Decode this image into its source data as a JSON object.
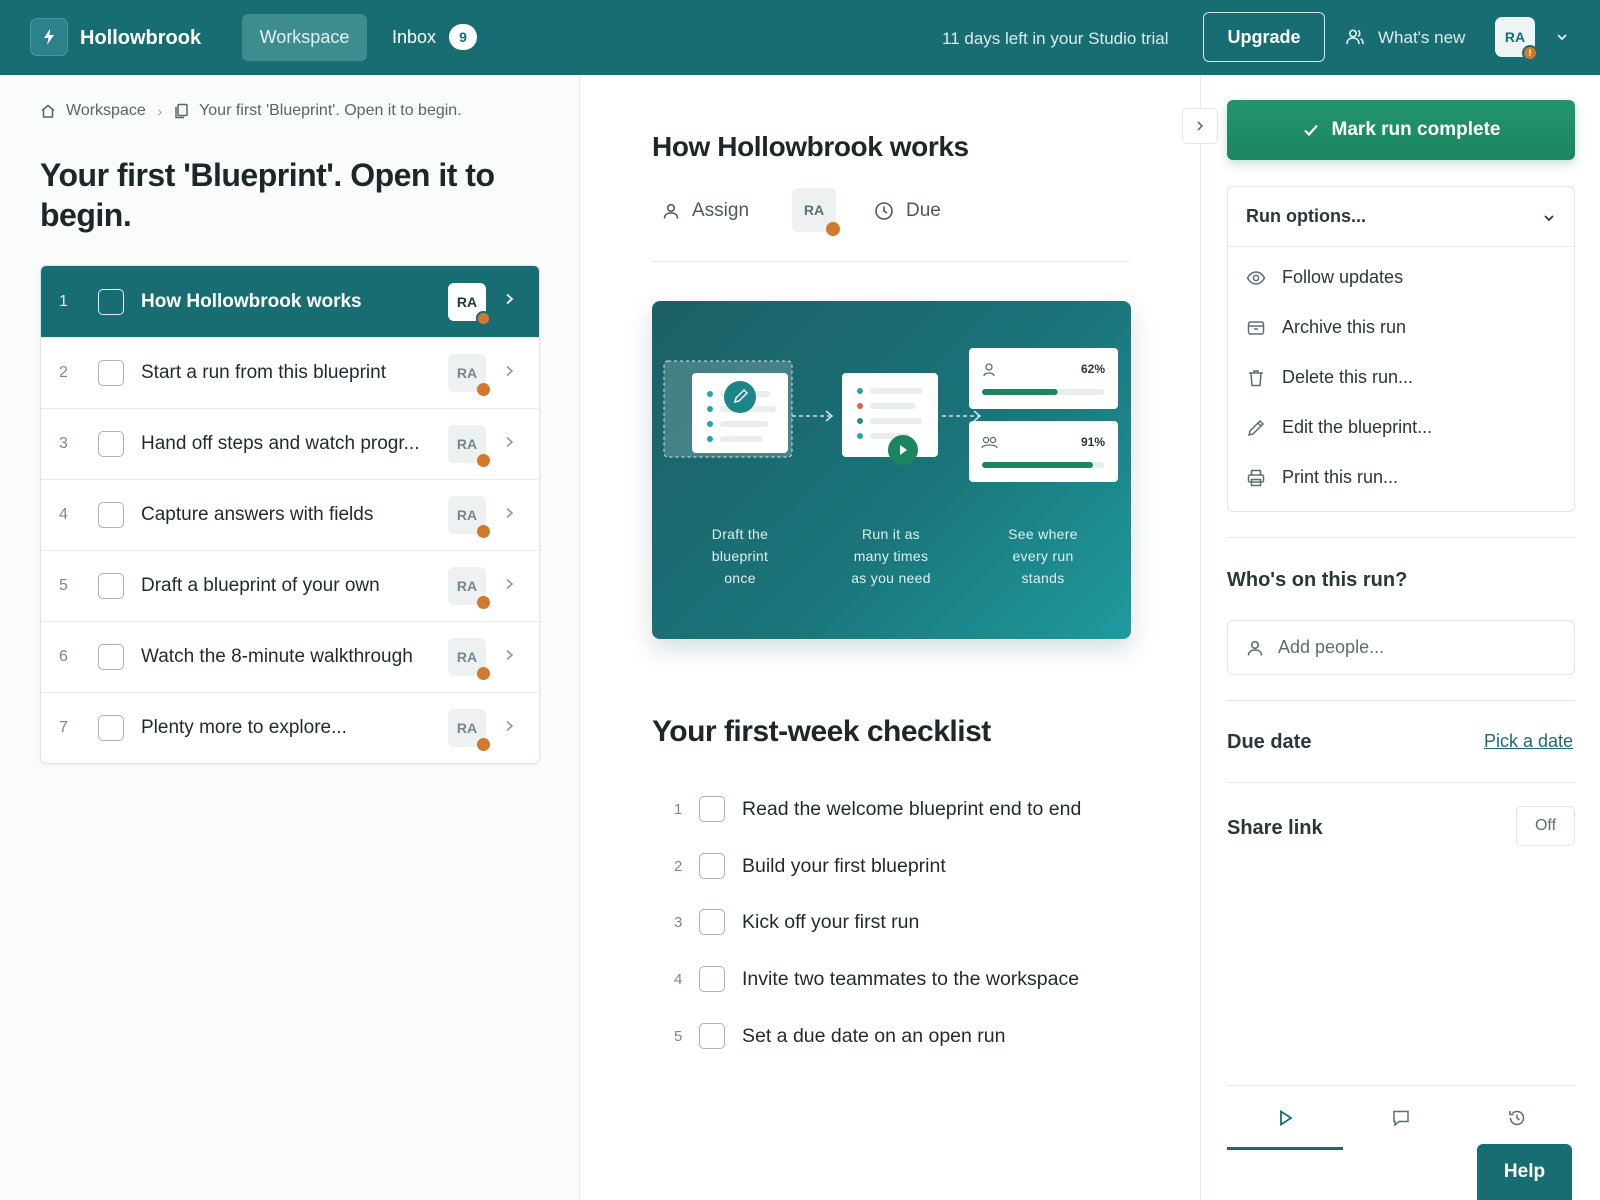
{
  "colors": {
    "brand": "#186d73",
    "success": "#1b8560",
    "avatar_alert": "#d17a2d"
  },
  "header": {
    "brand": "Hollowbrook",
    "nav_workspace": "Workspace",
    "nav_inbox": "Inbox",
    "inbox_count": "9",
    "trial_text": "11 days left in your Studio trial",
    "upgrade": "Upgrade",
    "whats_new": "What's new",
    "avatar": "RA",
    "avatar_alert": "!"
  },
  "breadcrumb": {
    "root": "Workspace",
    "current": "Your first 'Blueprint'. Open it to begin."
  },
  "page_title": "Your first 'Blueprint'. Open it to begin.",
  "steps": [
    {
      "num": "1",
      "label": "How Hollowbrook works",
      "avatar": "RA",
      "active": true
    },
    {
      "num": "2",
      "label": "Start a run from this blueprint",
      "avatar": "RA"
    },
    {
      "num": "3",
      "label": "Hand off steps and watch progr...",
      "avatar": "RA"
    },
    {
      "num": "4",
      "label": "Capture answers with fields",
      "avatar": "RA"
    },
    {
      "num": "5",
      "label": "Draft a blueprint of your own",
      "avatar": "RA"
    },
    {
      "num": "6",
      "label": "Watch the 8-minute walkthrough",
      "avatar": "RA"
    },
    {
      "num": "7",
      "label": "Plenty more to explore...",
      "avatar": "RA"
    }
  ],
  "main": {
    "step_title": "How Hollowbrook works",
    "assign": "Assign",
    "assignee_avatar": "RA",
    "due": "Due",
    "hero": {
      "caption_1": [
        "Draft the",
        "blueprint",
        "once"
      ],
      "caption_2": [
        "Run it as",
        "many times",
        "as you need"
      ],
      "caption_3": [
        "See where",
        "every run",
        "stands"
      ],
      "progress_1": "62%",
      "progress_1_value": 0.62,
      "progress_2": "91%",
      "progress_2_value": 0.91
    },
    "checklist_title": "Your first-week checklist",
    "checklist": [
      {
        "num": "1",
        "text": "Read the welcome blueprint end to end"
      },
      {
        "num": "2",
        "text": "Build your first blueprint"
      },
      {
        "num": "3",
        "text": "Kick off your first run"
      },
      {
        "num": "4",
        "text": "Invite two teammates to the workspace"
      },
      {
        "num": "5",
        "text": "Set a due date on an open run"
      }
    ]
  },
  "sidebar": {
    "complete_button": "Mark run complete",
    "run_options": "Run options...",
    "menu": [
      {
        "icon": "eye-icon",
        "label": "Follow updates"
      },
      {
        "icon": "archive-icon",
        "label": "Archive this run"
      },
      {
        "icon": "trash-icon",
        "label": "Delete this run..."
      },
      {
        "icon": "pencil-icon",
        "label": "Edit the blueprint..."
      },
      {
        "icon": "printer-icon",
        "label": "Print this run..."
      }
    ],
    "people_label": "Who's on this run?",
    "add_people_placeholder": "Add people...",
    "due_label": "Due date",
    "pick_date": "Pick a date",
    "share_label": "Share link",
    "share_state": "Off",
    "help": "Help"
  }
}
